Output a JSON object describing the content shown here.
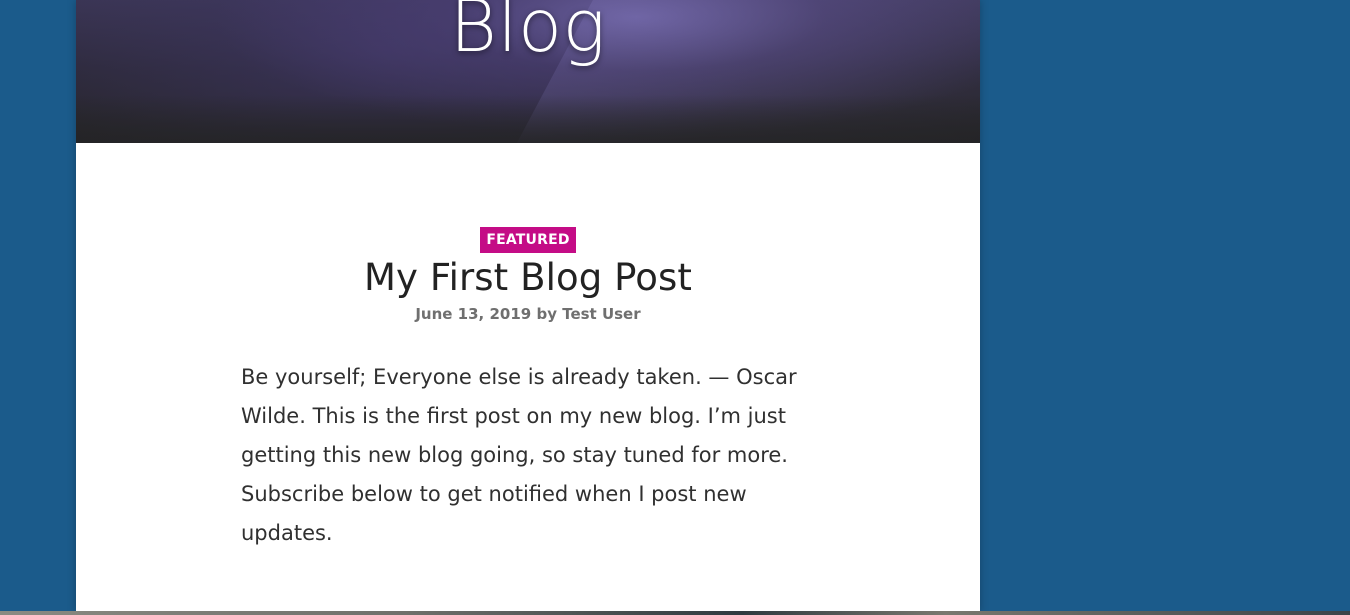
{
  "hero": {
    "title": "Blog"
  },
  "post": {
    "badge": "FEATURED",
    "title": "My First Blog Post",
    "date": "June 13, 2019",
    "byline": "by",
    "author": "Test User",
    "body": "Be yourself; Everyone else is already taken. — Oscar Wilde. This is the first post on my new blog. I’m just getting this new blog going, so stay tuned for more. Subscribe below to get notified when I post new updates."
  },
  "colors": {
    "page_background": "#1b5b8b",
    "content_background": "#ffffff",
    "badge_background": "#c40c86",
    "text_primary": "#222222",
    "text_meta": "#6f6f6f"
  }
}
